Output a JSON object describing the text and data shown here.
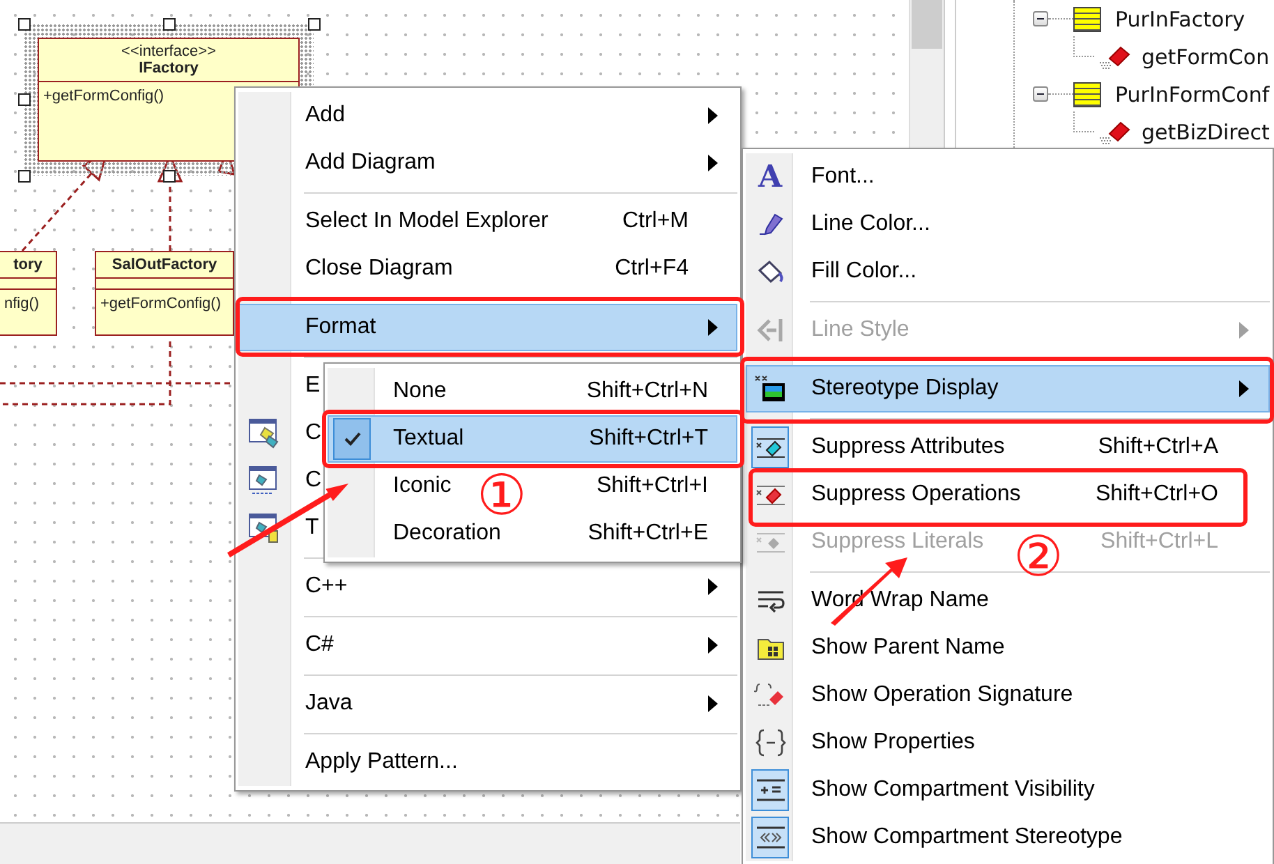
{
  "diagram": {
    "classes": [
      {
        "stereotype": "<<interface>>",
        "name": "IFactory",
        "operations": [
          "+getFormConfig()"
        ],
        "selected": true
      },
      {
        "name": "tory",
        "operations": [
          "nfig()"
        ],
        "selected": false
      },
      {
        "name": "SalOutFactory",
        "operations": [
          "+getFormConfig()"
        ],
        "selected": false
      }
    ]
  },
  "model_tree": {
    "items": [
      {
        "kind": "class",
        "name": "PurInFactory",
        "expanded": true,
        "children": [
          {
            "kind": "operation",
            "name": "getFormCon"
          }
        ]
      },
      {
        "kind": "class",
        "name": "PurInFormConf",
        "expanded": true,
        "children": [
          {
            "kind": "operation",
            "name": "getBizDirect"
          }
        ]
      }
    ]
  },
  "context_menu": {
    "items": [
      {
        "kind": "item",
        "label": "Add",
        "submenu": true,
        "selected": false
      },
      {
        "kind": "item",
        "label": "Add Diagram",
        "submenu": true,
        "selected": false
      },
      {
        "kind": "separator"
      },
      {
        "kind": "item",
        "label": "Select In Model Explorer",
        "shortcut": "Ctrl+M",
        "submenu": false,
        "selected": false
      },
      {
        "kind": "item",
        "label": "Close Diagram",
        "shortcut": "Ctrl+F4",
        "submenu": false,
        "selected": false
      },
      {
        "kind": "separator"
      },
      {
        "kind": "item",
        "label": "Format",
        "submenu": true,
        "selected": true
      },
      {
        "kind": "separator"
      },
      {
        "kind": "item",
        "label": "E",
        "submenu": false,
        "selected": false
      },
      {
        "kind": "item",
        "label": "C",
        "submenu": false,
        "selected": false
      },
      {
        "kind": "item",
        "label": "C",
        "submenu": false,
        "selected": false
      },
      {
        "kind": "item",
        "label": "T",
        "submenu": false,
        "selected": false
      },
      {
        "kind": "separator"
      },
      {
        "kind": "item",
        "label": "C++",
        "submenu": true,
        "selected": false
      },
      {
        "kind": "separator"
      },
      {
        "kind": "item",
        "label": "C#",
        "submenu": true,
        "selected": false
      },
      {
        "kind": "separator"
      },
      {
        "kind": "item",
        "label": "Java",
        "submenu": true,
        "selected": false
      },
      {
        "kind": "separator"
      },
      {
        "kind": "item",
        "label": "Apply Pattern...",
        "submenu": false,
        "selected": false
      }
    ]
  },
  "format_menu": {
    "items": [
      {
        "kind": "item",
        "icon_glyph": "A",
        "label": "Font...",
        "submenu": false,
        "selected": false,
        "checked": false,
        "disabled": false
      },
      {
        "kind": "item",
        "label": "Line Color...",
        "submenu": false,
        "selected": false,
        "checked": false,
        "disabled": false
      },
      {
        "kind": "item",
        "label": "Fill Color...",
        "submenu": false,
        "selected": false,
        "checked": false,
        "disabled": false
      },
      {
        "kind": "separator"
      },
      {
        "kind": "item",
        "label": "Line Style",
        "submenu": true,
        "selected": false,
        "checked": false,
        "disabled": true
      },
      {
        "kind": "separator"
      },
      {
        "kind": "item",
        "label": "Stereotype Display",
        "submenu": true,
        "selected": true,
        "checked": false,
        "disabled": false
      },
      {
        "kind": "separator"
      },
      {
        "kind": "item",
        "label": "Suppress Attributes",
        "shortcut": "Shift+Ctrl+A",
        "submenu": false,
        "selected": false,
        "checked": true,
        "disabled": false
      },
      {
        "kind": "item",
        "label": "Suppress Operations",
        "shortcut": "Shift+Ctrl+O",
        "submenu": false,
        "selected": false,
        "checked": false,
        "disabled": false
      },
      {
        "kind": "item",
        "label": "Suppress Literals",
        "shortcut": "Shift+Ctrl+L",
        "submenu": false,
        "selected": false,
        "checked": false,
        "disabled": true
      },
      {
        "kind": "separator"
      },
      {
        "kind": "item",
        "label": "Word Wrap Name",
        "submenu": false,
        "selected": false,
        "checked": false,
        "disabled": false
      },
      {
        "kind": "item",
        "label": "Show Parent Name",
        "submenu": false,
        "selected": false,
        "checked": false,
        "disabled": false
      },
      {
        "kind": "item",
        "label": "Show Operation Signature",
        "submenu": false,
        "selected": false,
        "checked": false,
        "disabled": false
      },
      {
        "kind": "item",
        "label": "Show Properties",
        "submenu": false,
        "selected": false,
        "checked": false,
        "disabled": false
      },
      {
        "kind": "item",
        "label": "Show Compartment Visibility",
        "submenu": false,
        "selected": false,
        "checked": true,
        "disabled": false
      },
      {
        "kind": "item",
        "label": "Show Compartment Stereotype",
        "submenu": false,
        "selected": false,
        "checked": true,
        "disabled": false
      }
    ]
  },
  "stereotype_menu": {
    "items": [
      {
        "kind": "item",
        "label": "None",
        "shortcut": "Shift+Ctrl+N",
        "selected": false,
        "checked": false
      },
      {
        "kind": "item",
        "label": "Textual",
        "shortcut": "Shift+Ctrl+T",
        "selected": true,
        "checked": true
      },
      {
        "kind": "item",
        "label": "Iconic",
        "shortcut": "Shift+Ctrl+I",
        "selected": false,
        "checked": false
      },
      {
        "kind": "item",
        "label": "Decoration",
        "shortcut": "Shift+Ctrl+E",
        "selected": false,
        "checked": false
      }
    ]
  },
  "annotations": [
    {
      "label": "①"
    },
    {
      "label": "②"
    }
  ]
}
